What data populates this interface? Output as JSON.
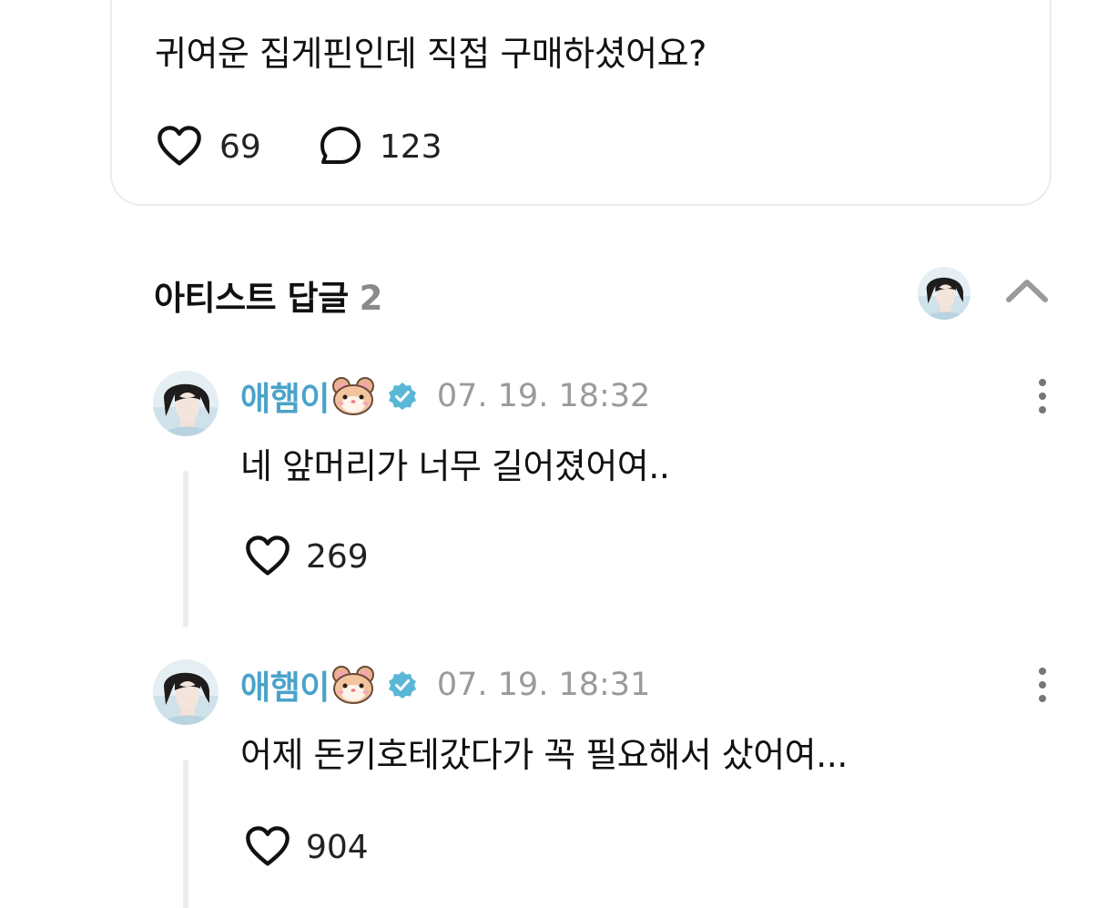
{
  "post": {
    "text": "귀여운 집게핀인데 직접 구매하셨어요?",
    "likes": "69",
    "comments": "123"
  },
  "artist_replies": {
    "title": "아티스트 답글",
    "count": "2"
  },
  "replies": [
    {
      "author": "애햄이",
      "emoji_icon": "hamster-face-icon",
      "time": "07. 19. 18:32",
      "text": "네 앞머리가 너무 길어졌어여..",
      "likes": "269"
    },
    {
      "author": "애햄이",
      "emoji_icon": "hamster-face-icon",
      "time": "07. 19. 18:31",
      "text": "어제 돈키호테갔다가 꼭 필요해서 샀어여...",
      "likes": "904"
    }
  ],
  "colors": {
    "author": "#4aa3c9",
    "verified": "#5ab7d6",
    "muted": "#9a9a9a",
    "divider": "#ececec"
  }
}
